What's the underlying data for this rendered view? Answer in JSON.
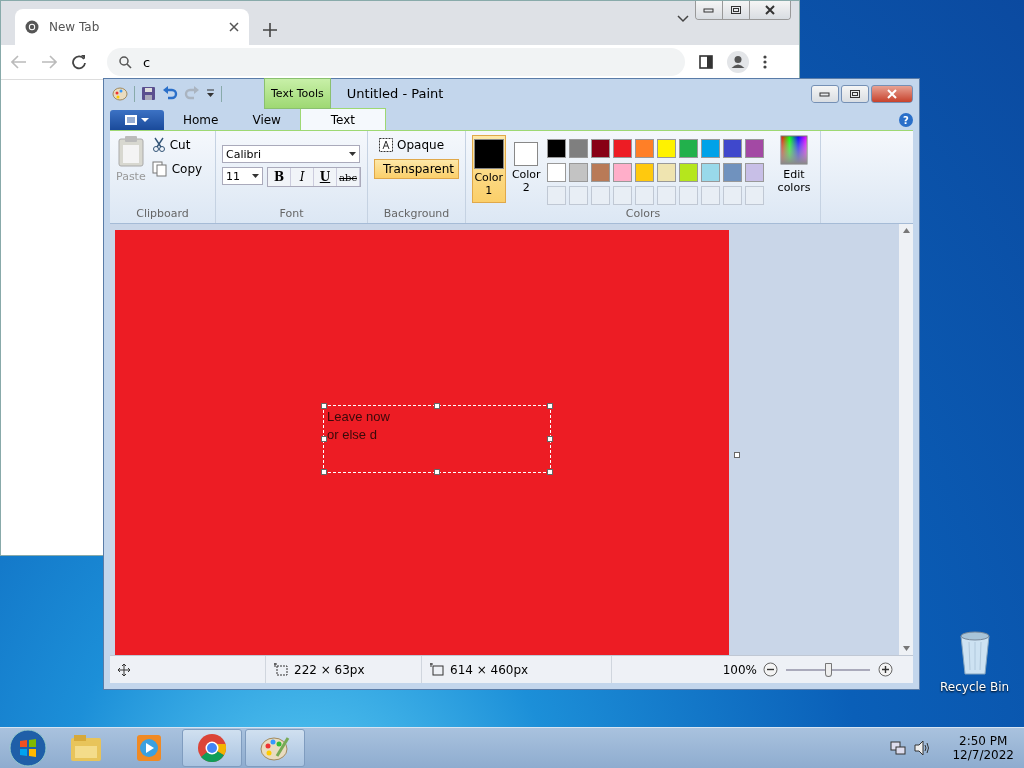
{
  "browser": {
    "tab": {
      "title": "New Tab"
    },
    "address": {
      "value": "c"
    }
  },
  "paint": {
    "title": "Untitled - Paint",
    "contextual_tab": "Text Tools",
    "help": "?",
    "tabs": [
      {
        "label": "Home",
        "selected": false
      },
      {
        "label": "View",
        "selected": false
      },
      {
        "label": "Text",
        "selected": true
      }
    ],
    "clipboard": {
      "group": "Clipboard",
      "paste": {
        "label": "Paste",
        "disabled": true
      },
      "cut": "Cut",
      "copy": "Copy"
    },
    "font": {
      "group": "Font",
      "family": "Calibri",
      "size": "11",
      "styles": [
        {
          "label": "B",
          "selected": false
        },
        {
          "label": "I",
          "selected": false
        },
        {
          "label": "U",
          "selected": false
        },
        {
          "label": "abc",
          "selected": false
        }
      ]
    },
    "background": {
      "group": "Background",
      "options": [
        {
          "label": "Opaque",
          "selected": false
        },
        {
          "label": "Transparent",
          "selected": true
        }
      ]
    },
    "colors": {
      "group": "Colors",
      "slots": [
        {
          "label": "Color 1",
          "color": "#000000",
          "selected": true
        },
        {
          "label": "Color 2",
          "color": "#ffffff",
          "selected": false
        }
      ],
      "palette": [
        {
          "color": "#000000"
        },
        {
          "color": "#7f7f7f"
        },
        {
          "color": "#880015"
        },
        {
          "color": "#ed1c24"
        },
        {
          "color": "#ff7f27"
        },
        {
          "color": "#fff200"
        },
        {
          "color": "#22b14c"
        },
        {
          "color": "#00a2e8"
        },
        {
          "color": "#3f48cc"
        },
        {
          "color": "#a349a4"
        },
        {
          "color": "#ffffff"
        },
        {
          "color": "#c3c3c3"
        },
        {
          "color": "#b97a57"
        },
        {
          "color": "#ffaec9"
        },
        {
          "color": "#ffc90e"
        },
        {
          "color": "#efe4b0"
        },
        {
          "color": "#b5e61d"
        },
        {
          "color": "#99d9ea"
        },
        {
          "color": "#7092be"
        },
        {
          "color": "#c8bfe7"
        }
      ],
      "edit_colors": "Edit colors"
    },
    "canvas": {
      "text_lines": [
        "Leave now",
        "or else d"
      ]
    },
    "status_bar": {
      "selection_size": "222 × 63px",
      "canvas_size": "614 × 460px",
      "zoom": "100%",
      "zoom_slider": {
        "level": 0.5
      }
    }
  },
  "desktop": {
    "recycle_bin": "Recycle Bin"
  },
  "taskbar": {
    "apps": [
      {
        "kind": "explorer",
        "running": false
      },
      {
        "kind": "media",
        "running": false
      },
      {
        "kind": "chrome",
        "running": true
      },
      {
        "kind": "paint",
        "running": true
      }
    ],
    "time": "2:50 PM",
    "date": "12/7/2022"
  }
}
